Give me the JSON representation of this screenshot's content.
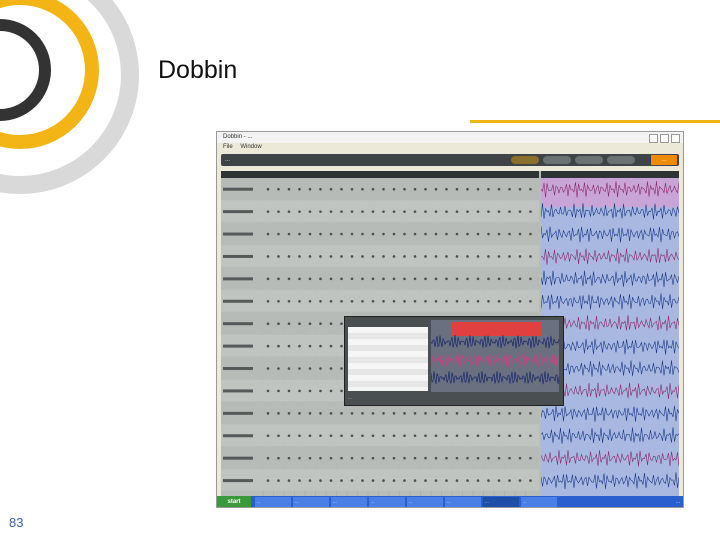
{
  "slide": {
    "title": "Dobbin",
    "number": "83"
  },
  "colors": {
    "accent_yellow": "#f2b515",
    "ring_grey": "#333333",
    "number_blue": "#3b5ea8"
  },
  "window": {
    "title": "Dobbin - ...",
    "menu": [
      "File",
      "Window"
    ],
    "breadcrumb": "...",
    "brand": "..."
  },
  "grid_rows": 14,
  "dialog": {
    "footer": "..."
  },
  "taskbar": {
    "start": "start",
    "tasks": [
      "...",
      "...",
      "...",
      "...",
      "...",
      "...",
      "...",
      "..."
    ],
    "clock": "..."
  }
}
